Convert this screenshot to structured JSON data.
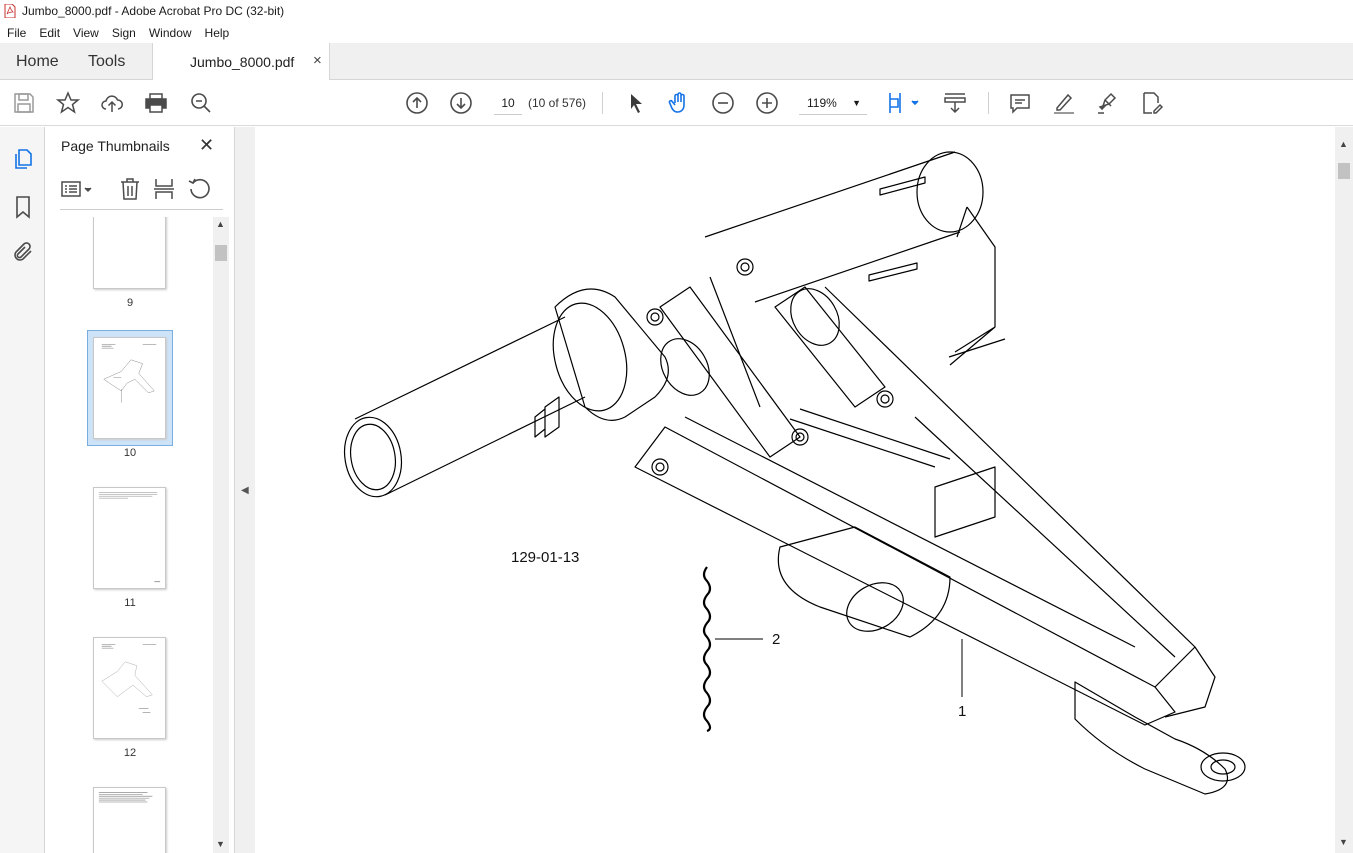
{
  "window": {
    "title": "Jumbo_8000.pdf - Adobe Acrobat Pro DC (32-bit)"
  },
  "menu": [
    "File",
    "Edit",
    "View",
    "Sign",
    "Window",
    "Help"
  ],
  "tabs": {
    "home": "Home",
    "tools": "Tools",
    "document": "Jumbo_8000.pdf",
    "close": "×"
  },
  "toolbar": {
    "page_value": "10",
    "page_of": "(10 of 576)",
    "zoom": "119%"
  },
  "panel": {
    "title": "Page Thumbnails",
    "close": "✕"
  },
  "thumbnails": [
    {
      "label": "9"
    },
    {
      "label": "10",
      "selected": true
    },
    {
      "label": "11"
    },
    {
      "label": "12"
    }
  ],
  "document": {
    "figure_code": "129-01-13",
    "callout_1": "1",
    "callout_2": "2"
  },
  "colors": {
    "accent": "#1473e6",
    "icon": "#4b4b4b",
    "selection": "#cde3f7"
  }
}
